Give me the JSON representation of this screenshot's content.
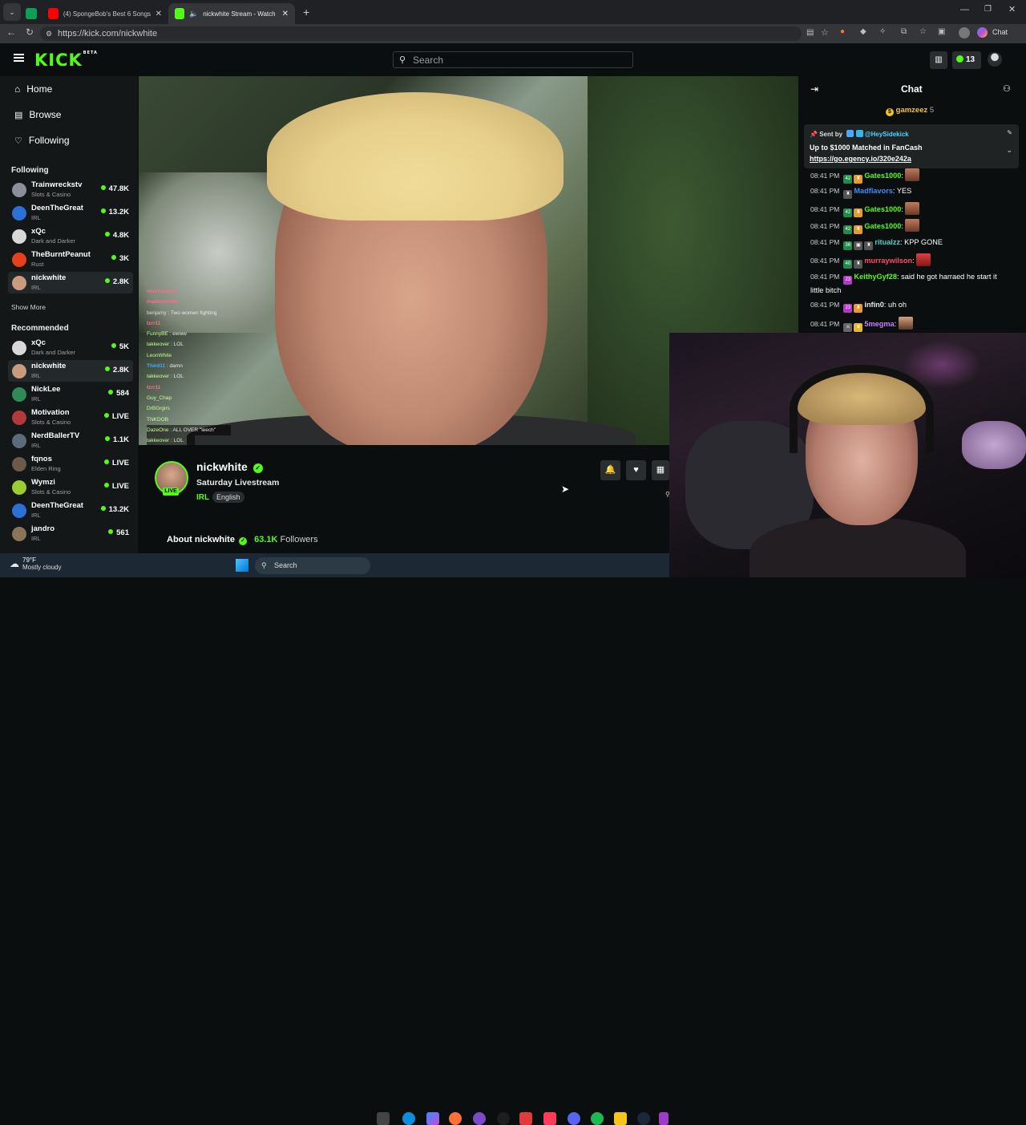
{
  "browser": {
    "tabs": [
      {
        "label": ""
      },
      {
        "label": "(4) SpongeBob's Best 6 Songs 🎼"
      },
      {
        "label": "nickwhite Stream - Watch Live"
      }
    ],
    "url": "https://kick.com/nickwhite",
    "chat_label": "Chat"
  },
  "header": {
    "logo": "KICK",
    "logo_tag": "BETA",
    "search_placeholder": "Search",
    "kicks_count": "13"
  },
  "sidebar": {
    "nav": [
      {
        "label": "Home"
      },
      {
        "label": "Browse"
      },
      {
        "label": "Following"
      }
    ],
    "following_title": "Following",
    "following": [
      {
        "name": "Trainwreckstv",
        "category": "Slots & Casino",
        "viewers": "47.8K"
      },
      {
        "name": "DeenTheGreat",
        "category": "IRL",
        "viewers": "13.2K"
      },
      {
        "name": "xQc",
        "category": "Dark and Darker",
        "viewers": "4.8K"
      },
      {
        "name": "TheBurntPeanut",
        "category": "Rust",
        "viewers": "3K"
      },
      {
        "name": "nickwhite",
        "category": "IRL",
        "viewers": "2.8K"
      }
    ],
    "show_more": "Show More",
    "recommended_title": "Recommended",
    "recommended": [
      {
        "name": "xQc",
        "category": "Dark and Darker",
        "viewers": "5K"
      },
      {
        "name": "nickwhite",
        "category": "IRL",
        "viewers": "2.8K"
      },
      {
        "name": "NickLee",
        "category": "IRL",
        "viewers": "584"
      },
      {
        "name": "Motivation",
        "category": "Slots & Casino",
        "viewers": "LIVE"
      },
      {
        "name": "NerdBallerTV",
        "category": "IRL",
        "viewers": "1.1K"
      },
      {
        "name": "fqnos",
        "category": "Elden Ring",
        "viewers": "LIVE"
      },
      {
        "name": "Wymzi",
        "category": "Slots & Casino",
        "viewers": "LIVE"
      },
      {
        "name": "DeenTheGreat",
        "category": "IRL",
        "viewers": "13.2K"
      },
      {
        "name": "jandro",
        "category": "IRL",
        "viewers": "561"
      }
    ]
  },
  "video_chat": [
    {
      "user": "realmsworld",
      "text": ""
    },
    {
      "user": "madmrfcwell",
      "text": ""
    },
    {
      "user": "benjamy",
      "text": "Two women fighting"
    },
    {
      "user": "tzrr11",
      "text": ""
    },
    {
      "user": "FunnyBE",
      "text": "ewww"
    },
    {
      "user": "takkeover",
      "text": "LOL"
    },
    {
      "user": "LeonWhite",
      "text": ""
    },
    {
      "user": "Third11",
      "text": "damn"
    },
    {
      "user": "takkeover",
      "text": "LOL"
    },
    {
      "user": "tzrr11",
      "text": ""
    },
    {
      "user": "Guy_Chap",
      "text": ""
    },
    {
      "user": "DrBGrgirs",
      "text": ""
    },
    {
      "user": "TNKDOB",
      "text": ""
    },
    {
      "user": "DazeOne",
      "text": "ALL OVER \"leech\""
    },
    {
      "user": "takkeover",
      "text": "LOL"
    }
  ],
  "stream": {
    "channel": "nickwhite",
    "title": "Saturday Livestream",
    "category": "IRL",
    "language": "English",
    "live_badge": "LIVE",
    "about_label": "About nickwhite",
    "followers_count": "63.1K",
    "followers_label": "Followers"
  },
  "chat": {
    "title": "Chat",
    "top_gifter": "gamzeez",
    "top_gifter_count": "5",
    "pinned": {
      "sent_by_label": "Sent by",
      "sender": "@HeySidekick",
      "text": "Up to $1000 Matched in FanCash",
      "link": "https://go.egency.io/320e242a"
    },
    "messages": [
      {
        "time": "08:41 PM",
        "badge": "42",
        "user": "Gates1000",
        "color": "#53fc18",
        "text": ""
      },
      {
        "time": "08:41 PM",
        "badge": "",
        "user": "Madflavors",
        "color": "#3d8bff",
        "text": "YES"
      },
      {
        "time": "08:41 PM",
        "badge": "42",
        "user": "Gates1000",
        "color": "#53fc18",
        "text": ""
      },
      {
        "time": "08:41 PM",
        "badge": "42",
        "user": "Gates1000",
        "color": "#53fc18",
        "text": ""
      },
      {
        "time": "08:41 PM",
        "badge": "36",
        "user": "ritualzz",
        "color": "#4fd4c8",
        "text": "KPP GONE"
      },
      {
        "time": "08:41 PM",
        "badge": "40",
        "user": "murraywilson",
        "color": "#ff4d6a",
        "text": ""
      },
      {
        "time": "08:41 PM",
        "badge": "23",
        "user": "KeithyGyf28",
        "color": "#53fc18",
        "text": "said he got harraed he start it little bitch"
      },
      {
        "time": "08:41 PM",
        "badge": "23",
        "user": "infin0",
        "color": "#e8e8e8",
        "text": "uh oh"
      },
      {
        "time": "08:41 PM",
        "badge": "",
        "user": "5megma",
        "color": "#c77dff",
        "text": ""
      }
    ]
  },
  "taskbar": {
    "weather_temp": "79°F",
    "weather_desc": "Mostly cloudy",
    "search_label": "Search"
  },
  "colors": {
    "brand": "#53fc18",
    "background": "#0b0e0f",
    "sidebar": "#141718"
  }
}
